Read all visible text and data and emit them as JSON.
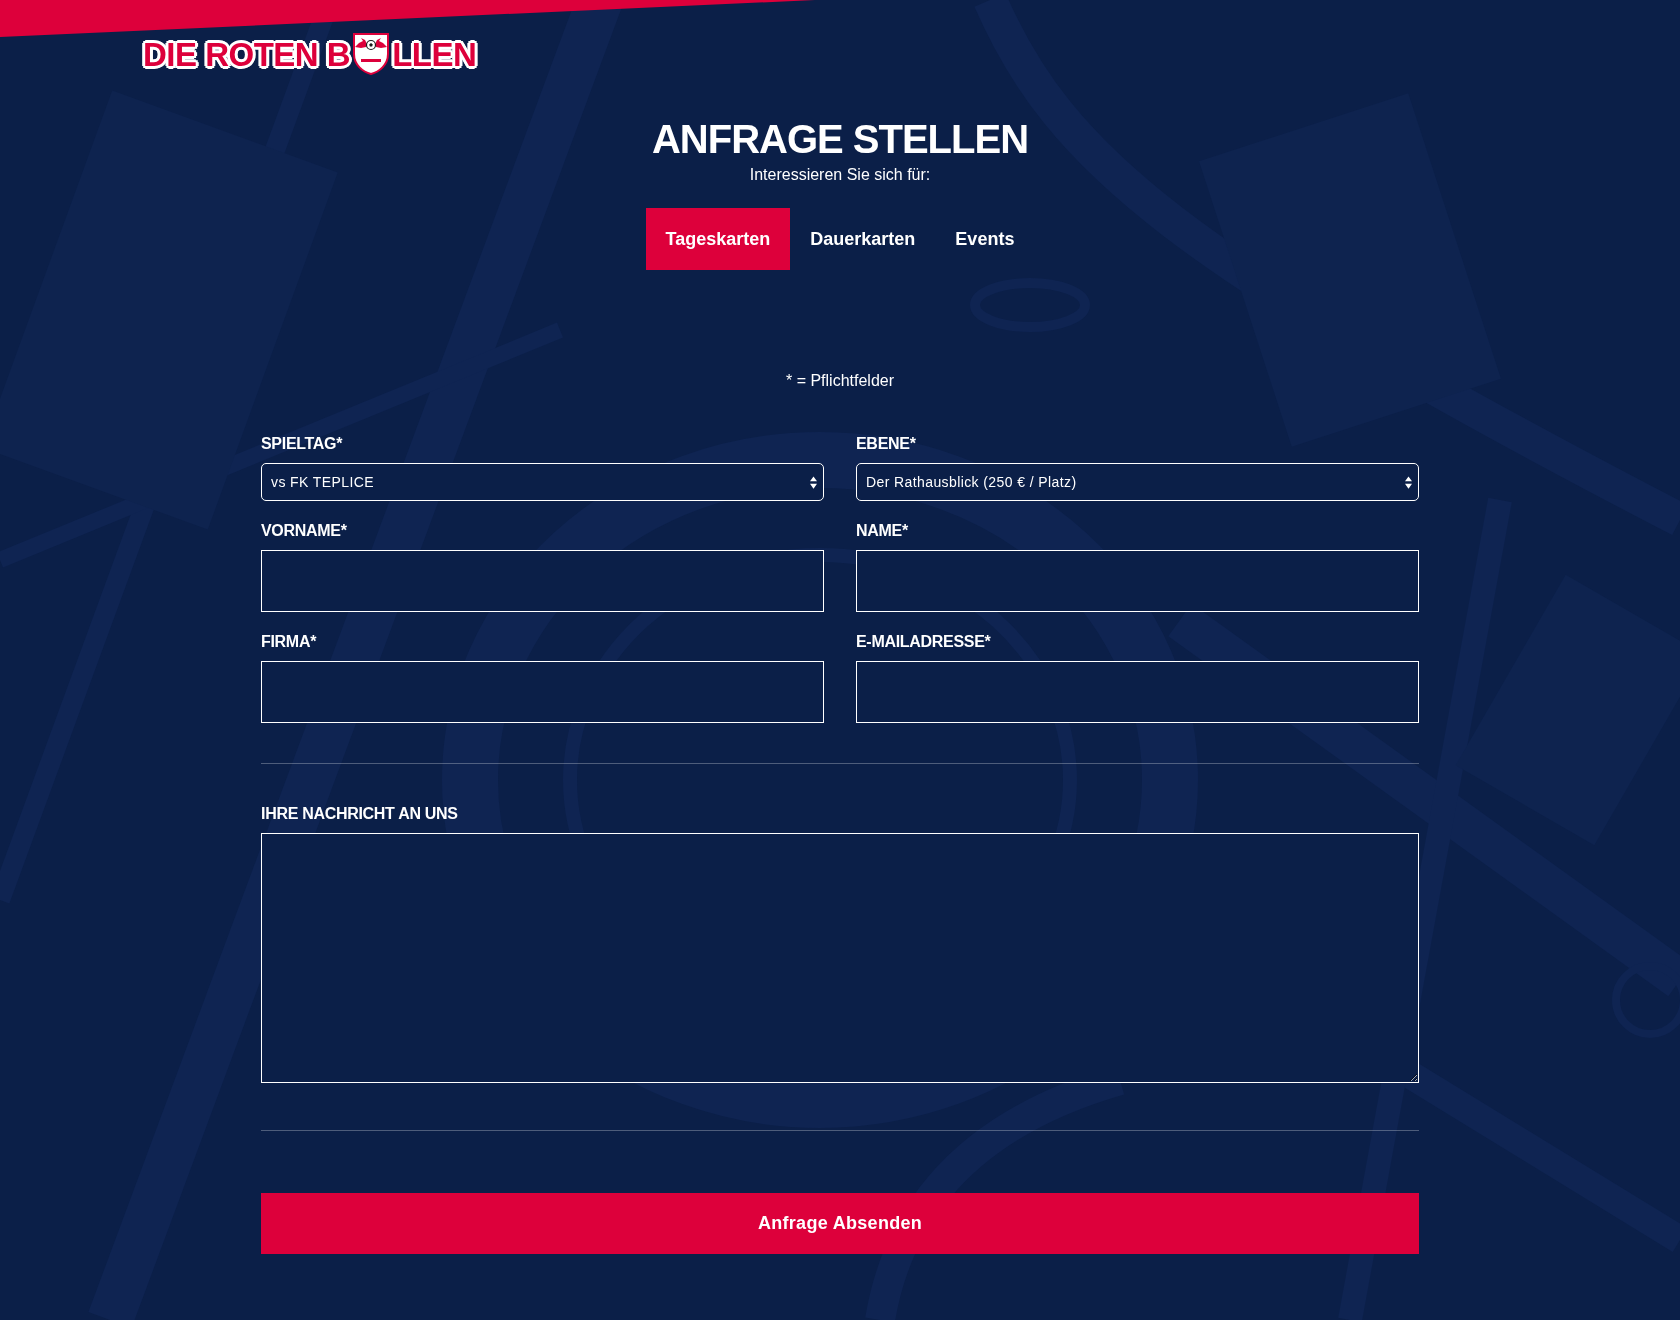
{
  "header": {
    "logo": {
      "text_before": "DIE ROTEN B",
      "text_after": "LLEN"
    }
  },
  "title": "ANFRAGE STELLEN",
  "subtitle": "Interessieren Sie sich für:",
  "tabs": [
    {
      "label": "Tageskarten",
      "selected": true
    },
    {
      "label": "Dauerkarten",
      "selected": false
    },
    {
      "label": "Events",
      "selected": false
    }
  ],
  "required_note": "* = Pflichtfelder",
  "fields": [
    {
      "kind": "select",
      "label": "SPIELTAG*",
      "value": "vs FK TEPLICE"
    },
    {
      "kind": "select",
      "label": "EBENE*",
      "value": "Der Rathausblick (250 € / Platz)"
    },
    {
      "kind": "text",
      "label": "VORNAME*"
    },
    {
      "kind": "text",
      "label": "NAME*"
    },
    {
      "kind": "text",
      "label": "FIRMA*"
    },
    {
      "kind": "text",
      "label": "E-MAILADRESSE*"
    }
  ],
  "message": {
    "label": "IHRE NACHRICHT AN UNS"
  },
  "submit_button": {
    "label": "Anfrage Absenden"
  }
}
